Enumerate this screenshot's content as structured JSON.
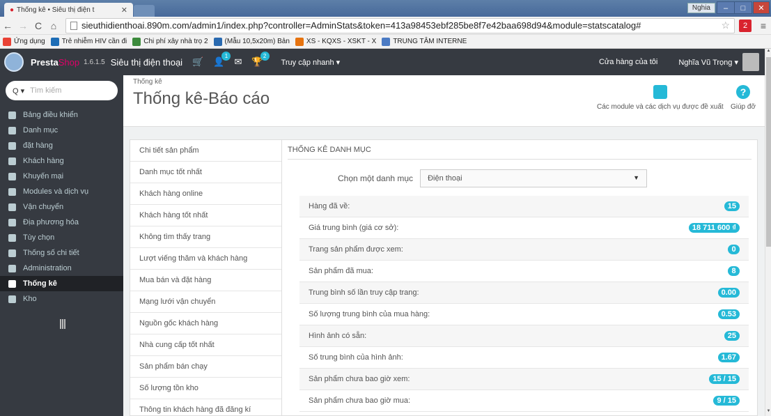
{
  "browser": {
    "tab_title": "Thống kê • Siêu thị điện t",
    "tab_close": "✕",
    "url": "sieuthidienthoai.890m.com/admin1/index.php?controller=AdminStats&token=413a98453ebf285be8f7e42baa698d94&module=statscatalog#",
    "user_label": "Nghia",
    "ext_label": "2",
    "bookmarks": [
      {
        "label": "Ứng dụng",
        "color": "#e94235"
      },
      {
        "label": "Trẻ nhiễm HIV cần đi",
        "color": "#1d6db6"
      },
      {
        "label": "Chi phí xây nhà trọ 2",
        "color": "#3d8b3d"
      },
      {
        "label": "(Mẫu 10,5x20m) Bản",
        "color": "#2a6ab0"
      },
      {
        "label": "XS - KQXS - XSKT - X",
        "color": "#e6730f"
      },
      {
        "label": "TRUNG TÂM INTERNE",
        "color": "#4b7bc4"
      }
    ]
  },
  "header": {
    "brand_presta": "Presta",
    "brand_shop": "Shop",
    "version": "1.6.1.5",
    "shop_name": "Siêu thị điện thoại",
    "badge_customers": "1",
    "badge_messages": "2",
    "quick_access": "Truy cập nhanh ▾",
    "my_shop": "Cửa hàng của tôi",
    "employee": "Nghĩa Vũ Trọng ▾"
  },
  "sidebar": {
    "search_placeholder": "Tìm kiếm",
    "items": [
      {
        "label": "Bảng điều khiển",
        "icon": "dashboard-icon"
      },
      {
        "label": "Danh mục",
        "icon": "book-icon"
      },
      {
        "label": "đặt hàng",
        "icon": "credit-card-icon"
      },
      {
        "label": "Khách hàng",
        "icon": "users-icon"
      },
      {
        "label": "Khuyến mại",
        "icon": "tag-icon"
      },
      {
        "label": "Modules và dịch vụ",
        "icon": "puzzle-icon"
      },
      {
        "label": "Vận chuyển",
        "icon": "truck-icon"
      },
      {
        "label": "Địa phương hóa",
        "icon": "globe-icon"
      },
      {
        "label": "Tùy chọn",
        "icon": "wrench-icon"
      },
      {
        "label": "Thống số chi tiết",
        "icon": "cogs-icon"
      },
      {
        "label": "Administration",
        "icon": "gear-icon"
      },
      {
        "label": "Thống kê",
        "icon": "bar-chart-icon"
      },
      {
        "label": "Kho",
        "icon": "archive-icon"
      }
    ]
  },
  "page": {
    "breadcrumb": "Thống kê",
    "title": "Thống kê-Báo cáo",
    "action_modules": "Các module và các dịch vụ được đề xuất",
    "action_help": "Giúp đỡ"
  },
  "stat_modules": [
    "Chi tiết sản phẩm",
    "Danh mục tốt nhất",
    "Khách hàng online",
    "Khách hàng tốt nhất",
    "Không tìm thấy trang",
    "Lượt viếng thăm và khách hàng",
    "Mua bán và đặt hàng",
    "Mạng lưới vận chuyển",
    "Nguồn gốc khách hàng",
    "Nhà cung cấp tốt nhất",
    "Sản phẩm bán chạy",
    "Số lượng tồn kho",
    "Thông tin khách hàng đã đăng kí"
  ],
  "panel": {
    "heading": "THỐNG KÊ DANH MỤC",
    "select_label": "Chọn một danh mục",
    "select_value": "Điện thoại",
    "rows": [
      {
        "label": "Hàng đã về:",
        "value": "15"
      },
      {
        "label": "Giá trung bình (giá cơ sở):",
        "value": "18 711 600 ₫"
      },
      {
        "label": "Trang sản phẩm được xem:",
        "value": "0"
      },
      {
        "label": "Sản phẩm đã mua:",
        "value": "8"
      },
      {
        "label": "Trung bình số lần truy cập trang:",
        "value": "0.00"
      },
      {
        "label": "Số lượng trung bình của mua hàng:",
        "value": "0.53"
      },
      {
        "label": "Hình ảnh có sẵn:",
        "value": "25"
      },
      {
        "label": "Số trung bình của hình ảnh:",
        "value": "1.67"
      },
      {
        "label": "Sản phẩm chưa bao giờ xem:",
        "value": "15 / 15"
      },
      {
        "label": "Sản phẩm chưa bao giờ mua:",
        "value": "9 / 15"
      }
    ]
  }
}
